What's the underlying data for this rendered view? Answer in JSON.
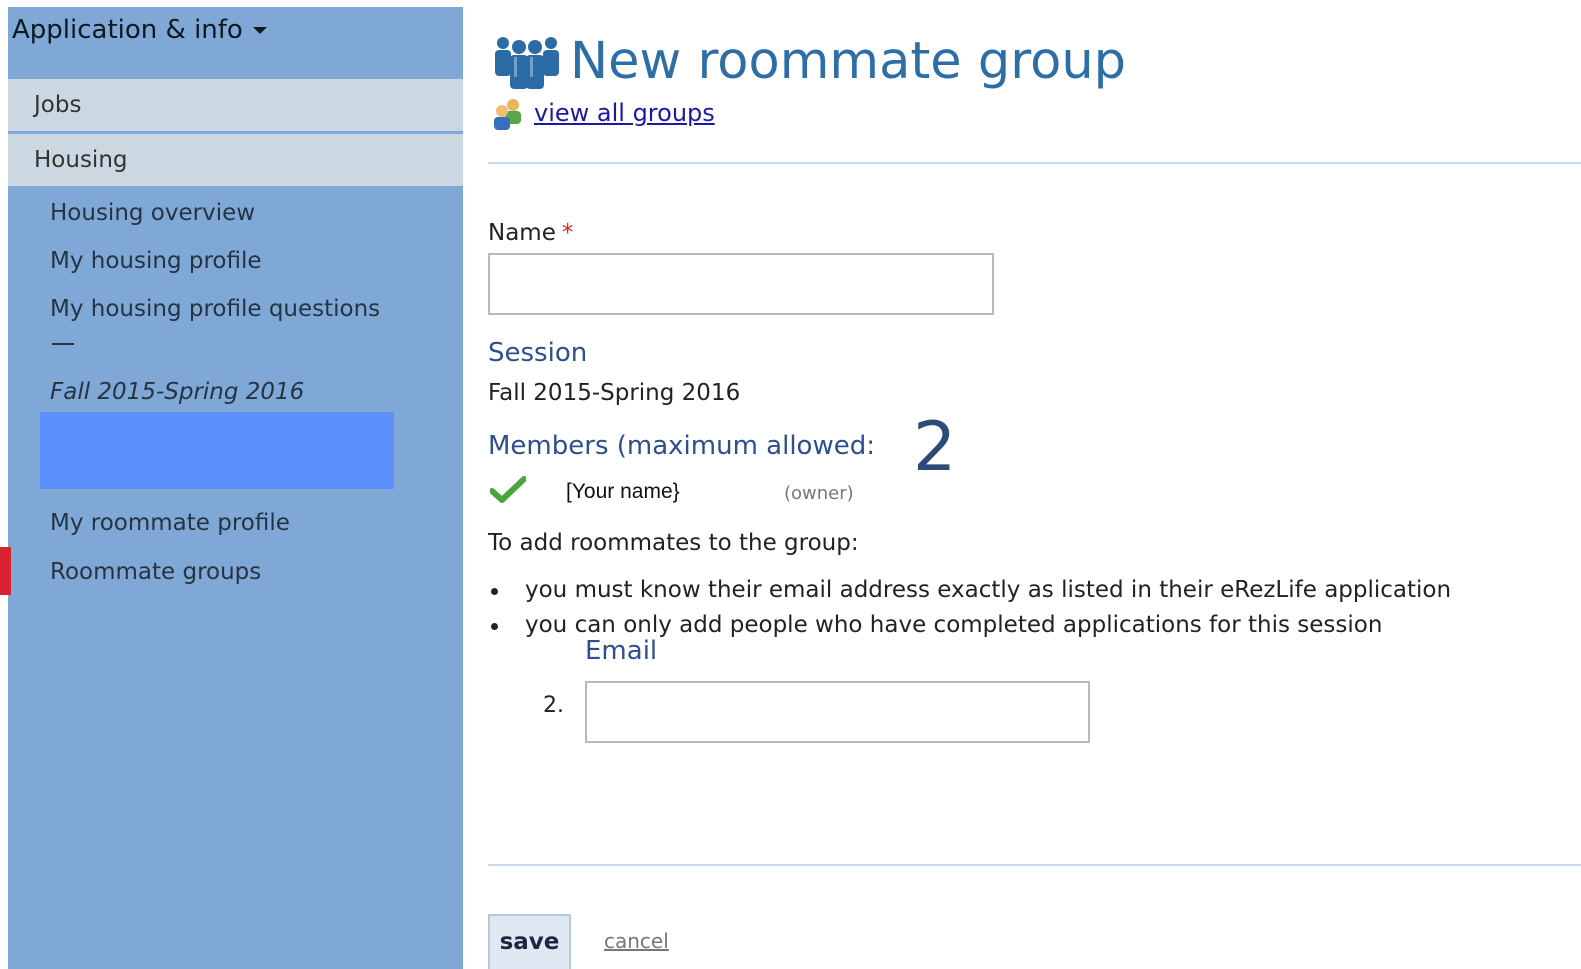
{
  "sidebar": {
    "header": "Application & info",
    "sections": [
      {
        "label": "Jobs"
      },
      {
        "label": "Housing"
      }
    ],
    "items": [
      {
        "label": "Housing overview"
      },
      {
        "label": "My housing profile"
      },
      {
        "label": "My housing profile questions"
      },
      {
        "label": "Fall 2015-Spring 2016"
      },
      {
        "label": "My roommate profile"
      },
      {
        "label": "Roommate groups"
      }
    ],
    "colors": {
      "background": "#7fa8d6",
      "section": "#cbd8e2",
      "highlight": "#5b8ffb",
      "active_marker": "#d8232f"
    }
  },
  "main": {
    "title": "New roommate group",
    "title_icon": "people-group-icon",
    "view_all_link": "view all groups",
    "view_all_icon": "users-icon",
    "name_label": "Name",
    "required_mark": "*",
    "name_value": "",
    "session_heading": "Session",
    "session_value": "Fall 2015-Spring 2016",
    "members_heading": "Members (maximum allowed:",
    "max_members": "2",
    "members": [
      {
        "name": "[Your name}",
        "role": "(owner)",
        "icon": "checkmark-icon"
      }
    ],
    "instructions_intro": "To add roommates to the group:",
    "bullets": [
      "you must know their email address exactly as listed in their eRezLife application",
      "you can only add people who have completed applications for this session"
    ],
    "email_label": "Email",
    "email_row_number": "2.",
    "email_value": "",
    "save_label": "save",
    "cancel_label": "cancel"
  }
}
